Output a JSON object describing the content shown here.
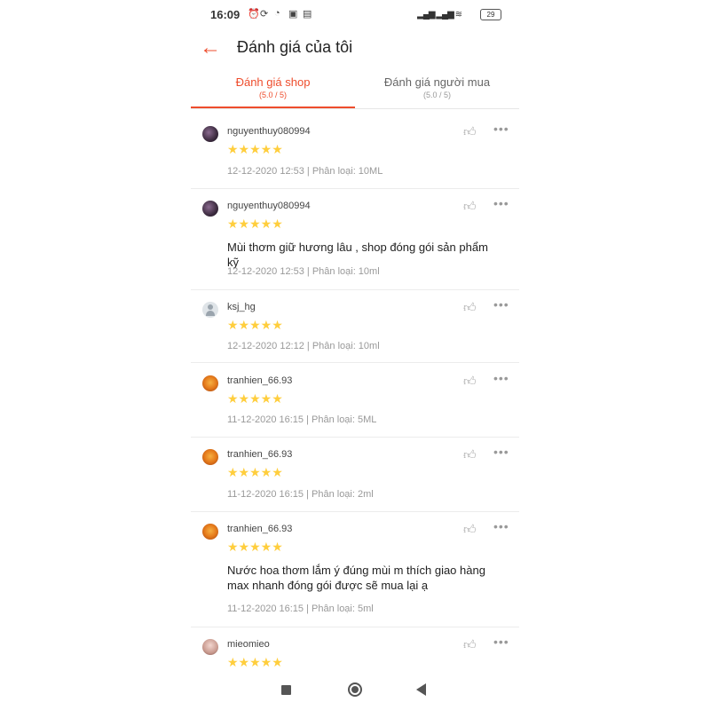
{
  "status_bar": {
    "time": "16:09",
    "battery": "29"
  },
  "header": {
    "title": "Đánh giá của tôi"
  },
  "tabs": [
    {
      "label": "Đánh giá shop",
      "score": "(5.0 / 5)"
    },
    {
      "label": "Đánh giá người mua",
      "score": "(5.0 / 5)"
    }
  ],
  "stars_text": "★★★★★",
  "reviews": [
    {
      "user": "nguyenthuy080994",
      "rating": 5,
      "comment": "",
      "meta": "12-12-2020 12:53 | Phân loại: 10ML",
      "avatar": "dark"
    },
    {
      "user": "nguyenthuy080994",
      "rating": 5,
      "comment": "Mùi thơm giữ hương lâu , shop đóng gói sản phẩm kỹ",
      "meta": "12-12-2020 12:53 | Phân loại: 10ml",
      "avatar": "dark"
    },
    {
      "user": "ksj_hg",
      "rating": 5,
      "comment": "",
      "meta": "12-12-2020 12:12 | Phân loại: 10ml",
      "avatar": "grey"
    },
    {
      "user": "tranhien_66.93",
      "rating": 5,
      "comment": "",
      "meta": "11-12-2020 16:15 | Phân loại: 5ML",
      "avatar": "orange"
    },
    {
      "user": "tranhien_66.93",
      "rating": 5,
      "comment": "",
      "meta": "11-12-2020 16:15 | Phân loại: 2ml",
      "avatar": "orange"
    },
    {
      "user": "tranhien_66.93",
      "rating": 5,
      "comment": "Nước hoa thơm lắm ý đúng mùi m thích giao hàng max nhanh đóng gói được sẽ mua lại ạ",
      "meta": "11-12-2020 16:15 | Phân loại: 5ml",
      "avatar": "orange"
    },
    {
      "user": "mieomieo",
      "rating": 5,
      "comment": "",
      "meta": "",
      "avatar": "pink"
    }
  ],
  "icons": {
    "back": "arrow-left-icon",
    "like": "thumbs-up-icon",
    "more": "more-dots-icon"
  },
  "colors": {
    "accent": "#ee4d2d",
    "star": "#ffce3d"
  }
}
